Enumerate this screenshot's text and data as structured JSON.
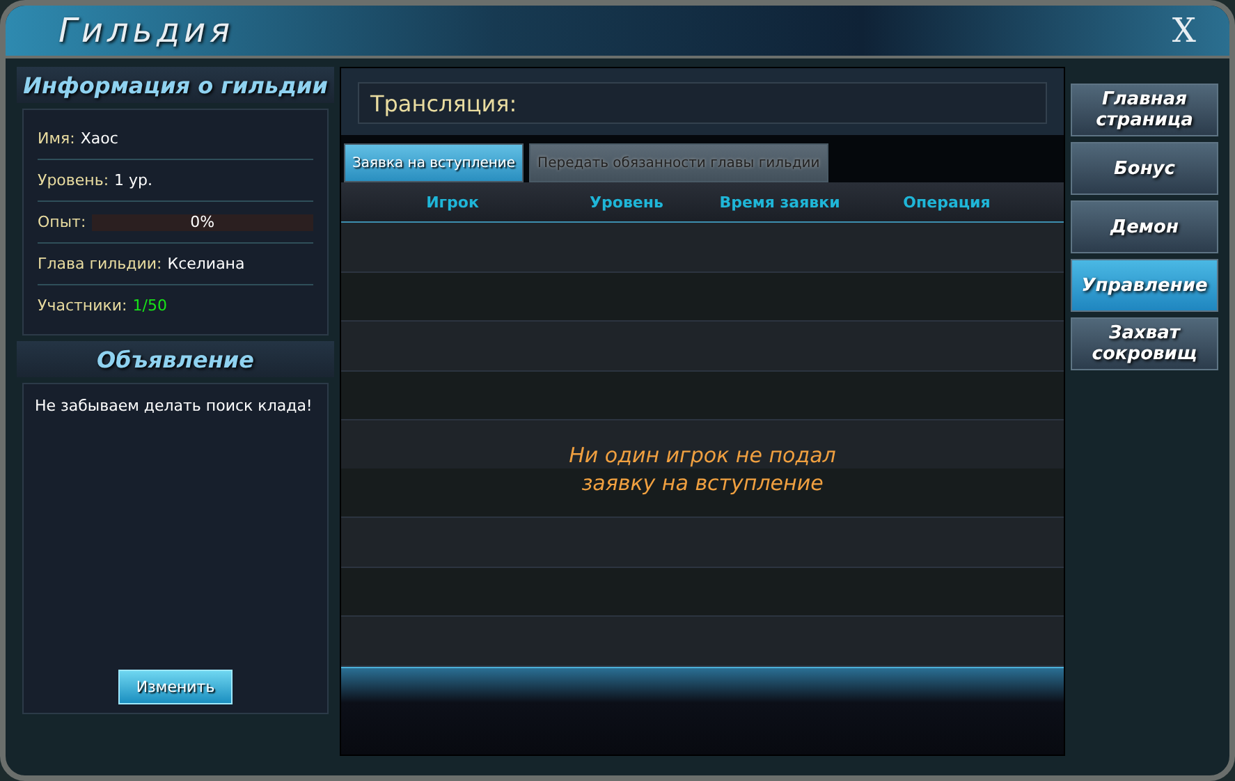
{
  "window": {
    "title": "Гильдия",
    "close": "X"
  },
  "guild_info": {
    "title": "Информация о гильдии",
    "rows": [
      {
        "kind": "text",
        "label": "Имя:",
        "value": "Хаос"
      },
      {
        "kind": "text",
        "label": "Уровень:",
        "value": "1 ур."
      },
      {
        "kind": "progress",
        "label": "Опыт:",
        "reading": "0%"
      },
      {
        "kind": "text",
        "label": "Глава гильдии:",
        "value": "Кселиана"
      },
      {
        "kind": "count",
        "label": "Участники:",
        "value": "1/50"
      }
    ]
  },
  "announcement": {
    "title": "Объявление",
    "text": "Не забываем делать поиск клада!",
    "button": "Изменить"
  },
  "broadcast": {
    "label": "Трансляция:"
  },
  "tabs": [
    {
      "label": "Заявка на вступление",
      "selected": true
    },
    {
      "label": "Передать обязанности главы гильдии",
      "selected": false
    }
  ],
  "table": {
    "columns": [
      "Игрок",
      "Уровень",
      "Время заявки",
      "Операция"
    ],
    "empty_message": "Ни один игрок не подал заявку на вступление"
  },
  "nav": [
    {
      "label": "Главная страница",
      "selected": false
    },
    {
      "label": "Бонус",
      "selected": false
    },
    {
      "label": "Демон",
      "selected": false
    },
    {
      "label": "Управление",
      "selected": true
    },
    {
      "label": "Захват сокровищ",
      "selected": false
    }
  ]
}
